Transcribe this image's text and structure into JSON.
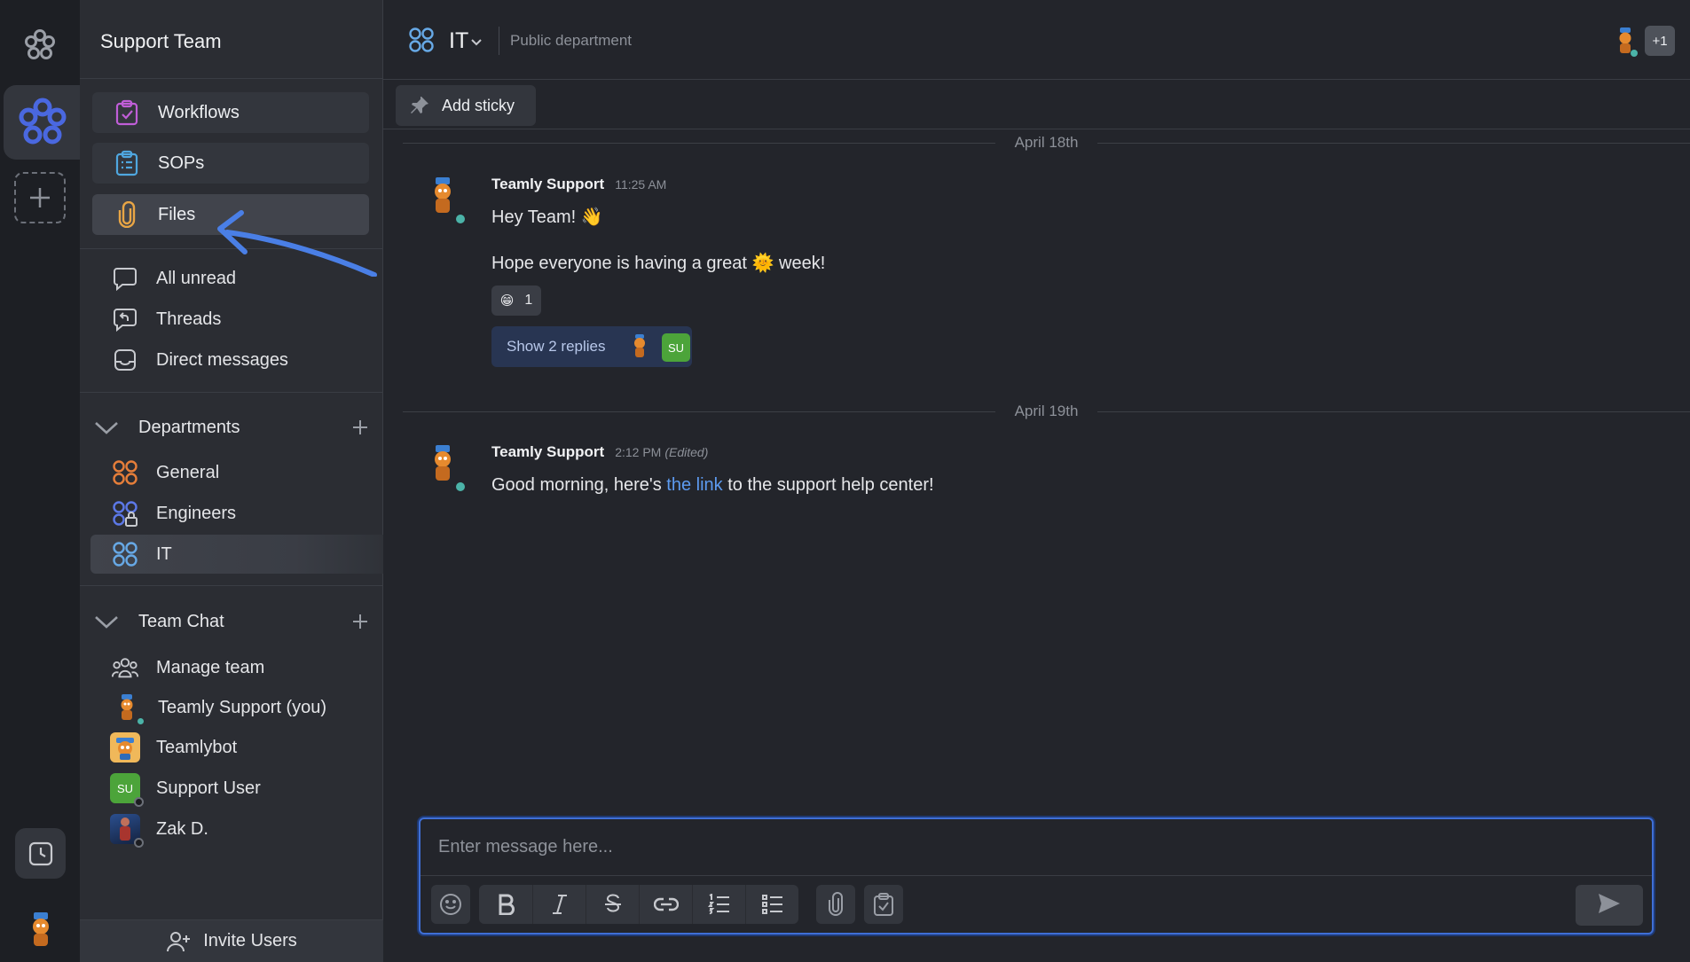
{
  "workspace": {
    "team_name": "Support Team"
  },
  "sidebar": {
    "tools": [
      {
        "label": "Workflows",
        "icon": "workflows-icon",
        "color": "#c05ed8"
      },
      {
        "label": "SOPs",
        "icon": "sops-icon",
        "color": "#4fa7e0"
      },
      {
        "label": "Files",
        "icon": "paperclip-icon",
        "color": "#e8a545"
      }
    ],
    "nav": [
      {
        "label": "All unread",
        "icon": "chat-bubble-icon"
      },
      {
        "label": "Threads",
        "icon": "threads-icon"
      },
      {
        "label": "Direct messages",
        "icon": "inbox-icon"
      }
    ],
    "departments": {
      "heading": "Departments",
      "items": [
        {
          "label": "General",
          "color": "#e67e3a"
        },
        {
          "label": "Engineers",
          "color": "#5c78e8",
          "locked": true
        },
        {
          "label": "IT",
          "color": "#67a9e6",
          "active": true
        }
      ]
    },
    "team_chat": {
      "heading": "Team Chat",
      "items": [
        {
          "label": "Manage team",
          "icon": "team-icon"
        },
        {
          "label": "Teamly Support (you)",
          "icon": "teamly-mascot-avatar",
          "status": "#4bb3a8"
        },
        {
          "label": "Teamlybot",
          "icon": "teamlybot-avatar"
        },
        {
          "label": "Support User",
          "initials": "SU",
          "status": "#1b1c20"
        },
        {
          "label": "Zak D.",
          "icon": "zak-avatar",
          "status": "#1b1c20"
        }
      ]
    },
    "invite_label": "Invite Users"
  },
  "channel": {
    "name": "IT",
    "subtitle": "Public department",
    "extra_members": "+1",
    "add_sticky_label": "Add sticky"
  },
  "messages": {
    "groups": [
      {
        "date": "April 18th",
        "author": "Teamly Support",
        "time": "11:25 AM",
        "lines": [
          "Hey Team! 👋"
        ],
        "line2_before": "Hope everyone is having a great",
        "line2_emoji": "🌞",
        "line2_after": "week!",
        "reaction": {
          "emoji": "😁",
          "count": "1"
        },
        "replies_label": "Show 2 replies",
        "replies_initials": "SU"
      },
      {
        "date": "April 19th",
        "author": "Teamly Support",
        "time": "2:12 PM",
        "edited": "(Edited)",
        "text_before": "Good morning, here's",
        "link": "the link",
        "text_after": "to the support help center!"
      }
    ]
  },
  "composer": {
    "placeholder": "Enter message here..."
  },
  "colors": {
    "accent": "#3f6fd6",
    "brand": "#4a68e0",
    "link": "#5d9bf0",
    "online": "#4bb3a8"
  }
}
